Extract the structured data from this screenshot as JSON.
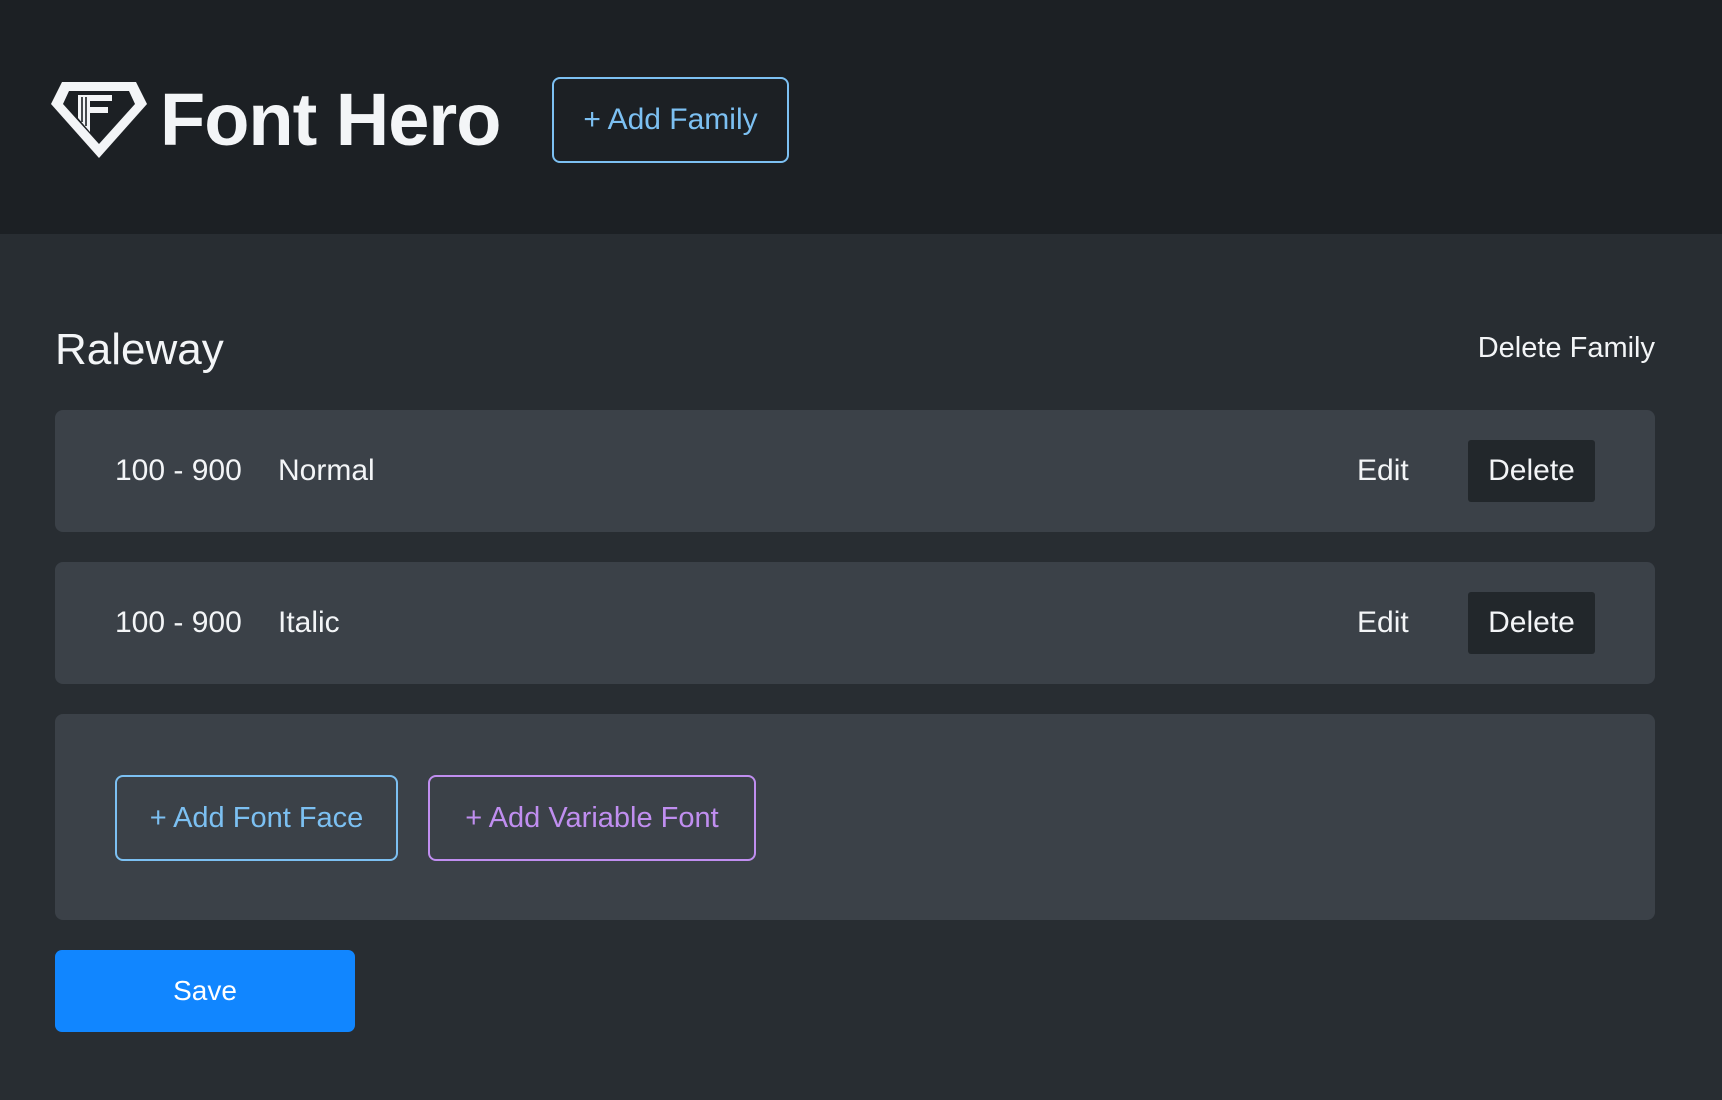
{
  "header": {
    "brand_name": "Font Hero",
    "add_family_label": "+ Add Family"
  },
  "family": {
    "name": "Raleway",
    "delete_family_label": "Delete Family",
    "faces": [
      {
        "weight": "100 - 900",
        "style": "Normal",
        "edit_label": "Edit",
        "delete_label": "Delete"
      },
      {
        "weight": "100 - 900",
        "style": "Italic",
        "edit_label": "Edit",
        "delete_label": "Delete"
      }
    ],
    "add_font_face_label": "+ Add Font Face",
    "add_variable_font_label": "+ Add Variable Font"
  },
  "save_label": "Save",
  "icons": {
    "logo": "diamond-f-logo-icon"
  },
  "colors": {
    "header_bg": "#1c2024",
    "page_bg": "#282d32",
    "panel_bg": "#3b4148",
    "accent_blue": "#7cc0f2",
    "accent_purple": "#c08ef0",
    "save_blue": "#1186ff",
    "delete_btn_bg": "#22272b"
  }
}
